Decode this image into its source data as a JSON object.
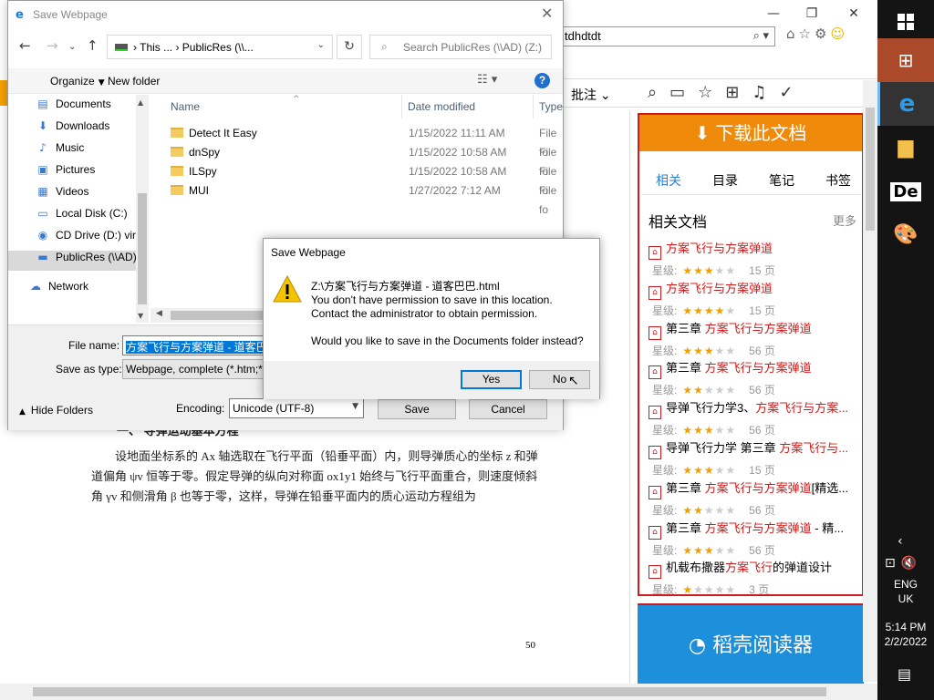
{
  "browser": {
    "address_value": "tdhdtdt",
    "toolbar_label": "批注",
    "window_controls": [
      "—",
      "❐",
      "✕"
    ]
  },
  "document": {
    "section_heading": "一、   导弹运动基本方程",
    "paragraph": "设地面坐标系的 Ax 轴选取在飞行平面（铅垂平面）内，则导弹质心的坐标 z 和弹道偏角 ψv 恒等于零。假定导弹的纵向对称面 ox1y1 始终与飞行平面重合，则速度倾斜角 γv 和侧滑角 β 也等于零，这样，导弹在铅垂平面内的质心运动方程组为",
    "page_number": "50"
  },
  "sidebar": {
    "download_label": "下载此文档",
    "tabs": [
      "相关",
      "目录",
      "笔记",
      "书签"
    ],
    "related_title": "相关文档",
    "more_label": "更多",
    "rating_label": "星级:",
    "pages_suffix": "页",
    "docs": [
      {
        "prefix": "",
        "highlight": "方案飞行与方案弹道",
        "suffix": "",
        "stars": 3,
        "pages": "15"
      },
      {
        "prefix": "",
        "highlight": "方案飞行与方案弹道",
        "suffix": "",
        "stars": 4,
        "pages": "15"
      },
      {
        "prefix": "第三章 ",
        "highlight": "方案飞行与方案弹道",
        "suffix": "",
        "stars": 3,
        "pages": "56"
      },
      {
        "prefix": "第三章 ",
        "highlight": "方案飞行与方案弹道",
        "suffix": "",
        "stars": 2,
        "pages": "56"
      },
      {
        "prefix": "导弹飞行力学3、",
        "highlight": "方案飞行与方案...",
        "suffix": "",
        "stars": 3,
        "pages": "56"
      },
      {
        "prefix": "导弹飞行力学 第三章 ",
        "highlight": "方案飞行与...",
        "suffix": "",
        "stars": 3,
        "pages": "15"
      },
      {
        "prefix": "第三章 ",
        "highlight": "方案飞行与方案弹道",
        "suffix": "[精选...",
        "stars": 2,
        "pages": "56"
      },
      {
        "prefix": "第三章 ",
        "highlight": "方案飞行与方案弹道",
        "suffix": " - 精...",
        "stars": 3,
        "pages": "56"
      },
      {
        "prefix": "机载布撒器",
        "highlight": "方案飞行",
        "suffix": "的弹道设计",
        "stars": 1,
        "pages": "3"
      }
    ],
    "banner_label": "稻壳阅读器"
  },
  "save_dialog": {
    "title": "Save Webpage",
    "path_crumbs": "This ...  ›  PublicRes (\\\\...",
    "search_placeholder": "Search PublicRes (\\\\AD) (Z:)",
    "organize_label": "Organize",
    "new_folder_label": "New folder",
    "nav_items": [
      {
        "icon": "documents-icon",
        "glyph": "▤",
        "label": "Documents"
      },
      {
        "icon": "downloads-icon",
        "glyph": "⬇",
        "label": "Downloads"
      },
      {
        "icon": "music-icon",
        "glyph": "♪",
        "label": "Music"
      },
      {
        "icon": "pictures-icon",
        "glyph": "▣",
        "label": "Pictures"
      },
      {
        "icon": "videos-icon",
        "glyph": "▦",
        "label": "Videos"
      },
      {
        "icon": "local-disk-icon",
        "glyph": "▭",
        "label": "Local Disk (C:)"
      },
      {
        "icon": "cd-drive-icon",
        "glyph": "◉",
        "label": "CD Drive (D:) virt"
      },
      {
        "icon": "network-drive-icon",
        "glyph": "▬",
        "label": "PublicRes (\\\\AD)"
      },
      {
        "icon": "network-icon",
        "glyph": "☁",
        "label": "Network"
      }
    ],
    "columns": [
      "Name",
      "Date modified",
      "Type"
    ],
    "files": [
      {
        "name": "Detect It Easy",
        "date": "1/15/2022 11:11 AM",
        "type": "File fo"
      },
      {
        "name": "dnSpy",
        "date": "1/15/2022 10:58 AM",
        "type": "File fo"
      },
      {
        "name": "ILSpy",
        "date": "1/15/2022 10:58 AM",
        "type": "File fo"
      },
      {
        "name": "MUI",
        "date": "1/27/2022 7:12 AM",
        "type": "File fo"
      }
    ],
    "file_name_label": "File name:",
    "file_name_value": "方案飞行与方案弹道 - 道客巴",
    "save_type_label": "Save as type:",
    "save_type_value": "Webpage, complete (*.htm;*",
    "hide_folders_label": "Hide Folders",
    "encoding_label": "Encoding:",
    "encoding_value": "Unicode (UTF-8)",
    "save_button": "Save",
    "cancel_button": "Cancel"
  },
  "message_box": {
    "title": "Save Webpage",
    "path": "Z:\\方案飞行与方案弹道 - 道客巴巴.html",
    "line1": "You don't have permission to save in this location.",
    "line2": "Contact the administrator to obtain permission.",
    "question": "Would you like to save in the Documents folder instead?",
    "yes_button": "Yes",
    "no_button": "No"
  },
  "taskbar": {
    "lang_line1": "ENG",
    "lang_line2": "UK",
    "time": "5:14 PM",
    "date": "2/2/2022"
  }
}
